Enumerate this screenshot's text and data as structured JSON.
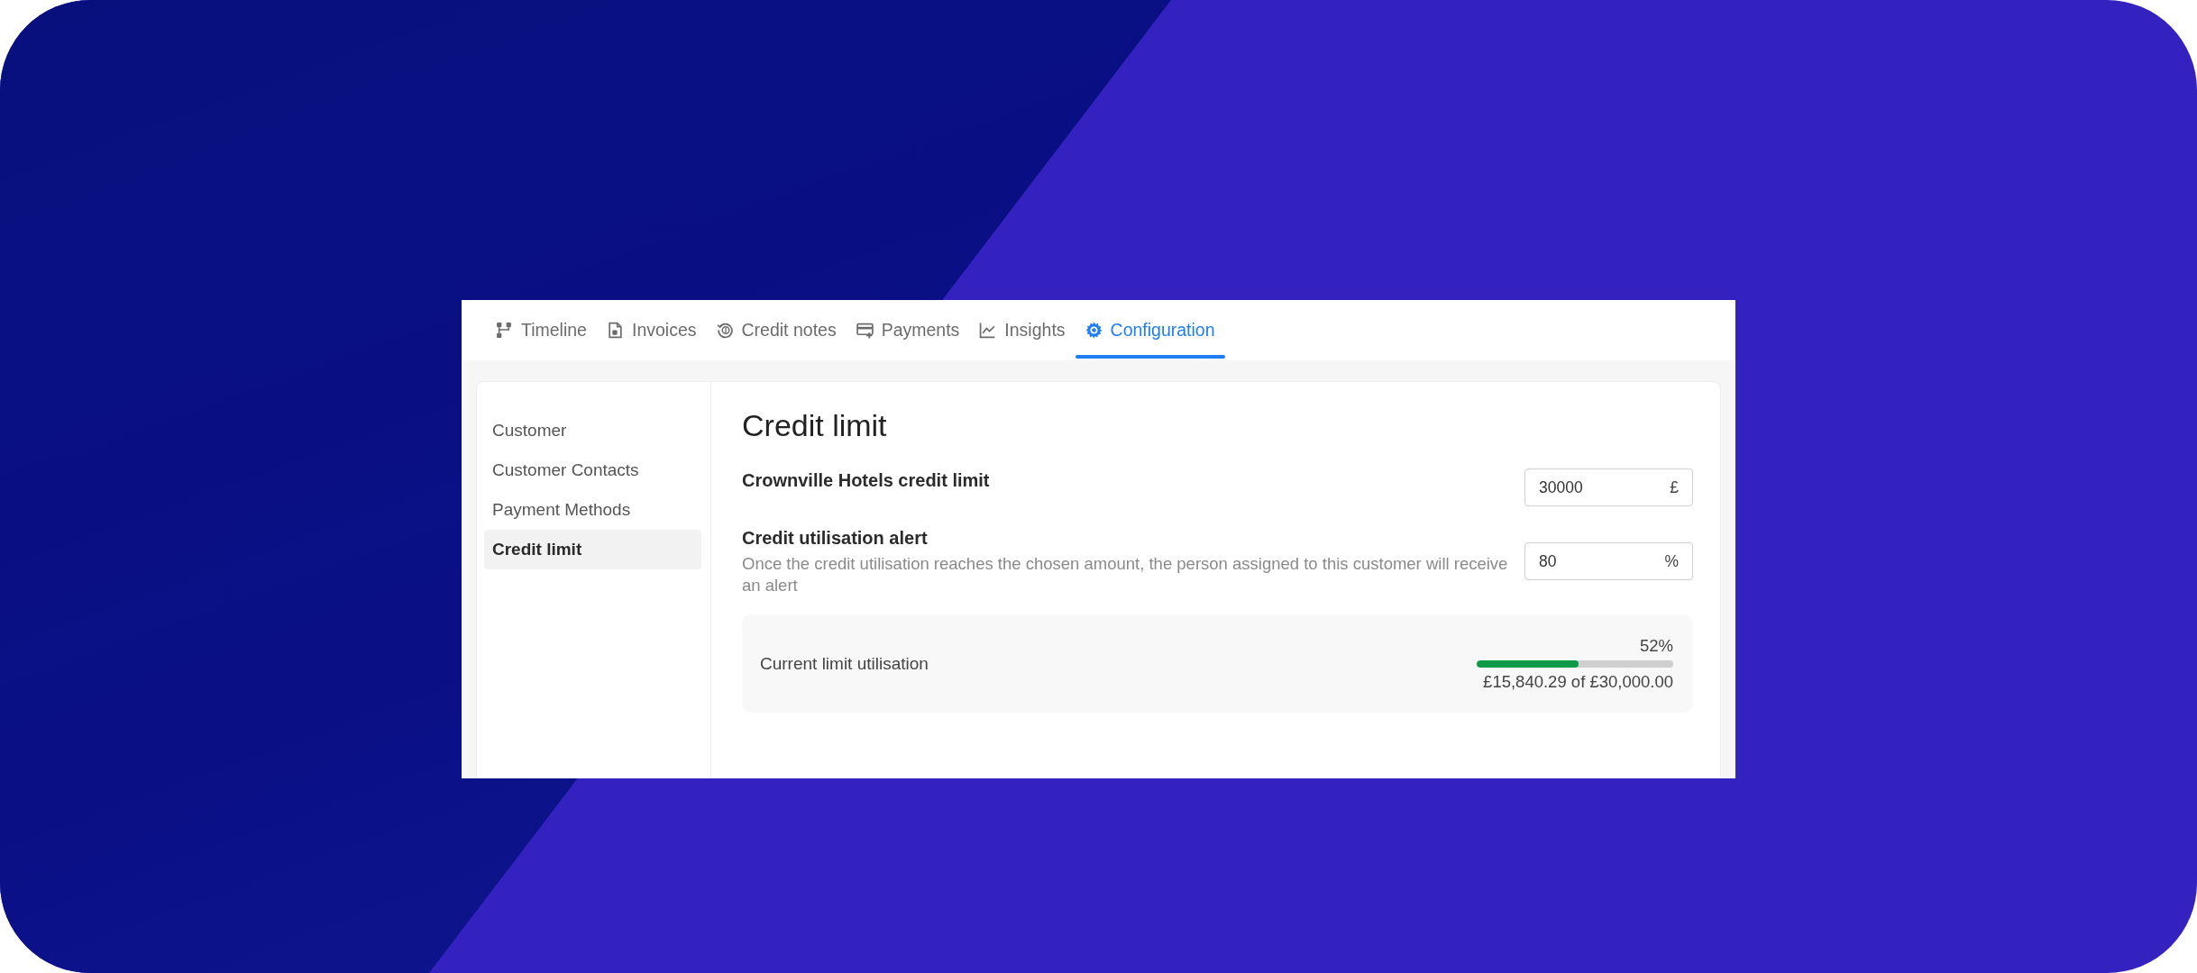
{
  "tabs": [
    {
      "label": "Timeline",
      "selected": false
    },
    {
      "label": "Invoices",
      "selected": false
    },
    {
      "label": "Credit notes",
      "selected": false
    },
    {
      "label": "Payments",
      "selected": false
    },
    {
      "label": "Insights",
      "selected": false
    },
    {
      "label": "Configuration",
      "selected": true
    }
  ],
  "sidebar": {
    "items": [
      {
        "label": "Customer",
        "selected": false
      },
      {
        "label": "Customer Contacts",
        "selected": false
      },
      {
        "label": "Payment Methods",
        "selected": false
      },
      {
        "label": "Credit limit",
        "selected": true
      }
    ]
  },
  "section": {
    "title": "Credit limit",
    "settings": [
      {
        "label": "Crownville Hotels credit limit",
        "value": "30000",
        "suffix": "£"
      },
      {
        "label": "Credit utilisation alert",
        "description": "Once the credit utilisation reaches the chosen amount, the person assigned to this customer will receive an alert",
        "value": "80",
        "suffix": "%"
      }
    ]
  },
  "utilisation": {
    "label": "Current limit utilisation",
    "percent": "52%",
    "level": 0.52,
    "amount": "£15,840.29 of £30,000.00"
  }
}
